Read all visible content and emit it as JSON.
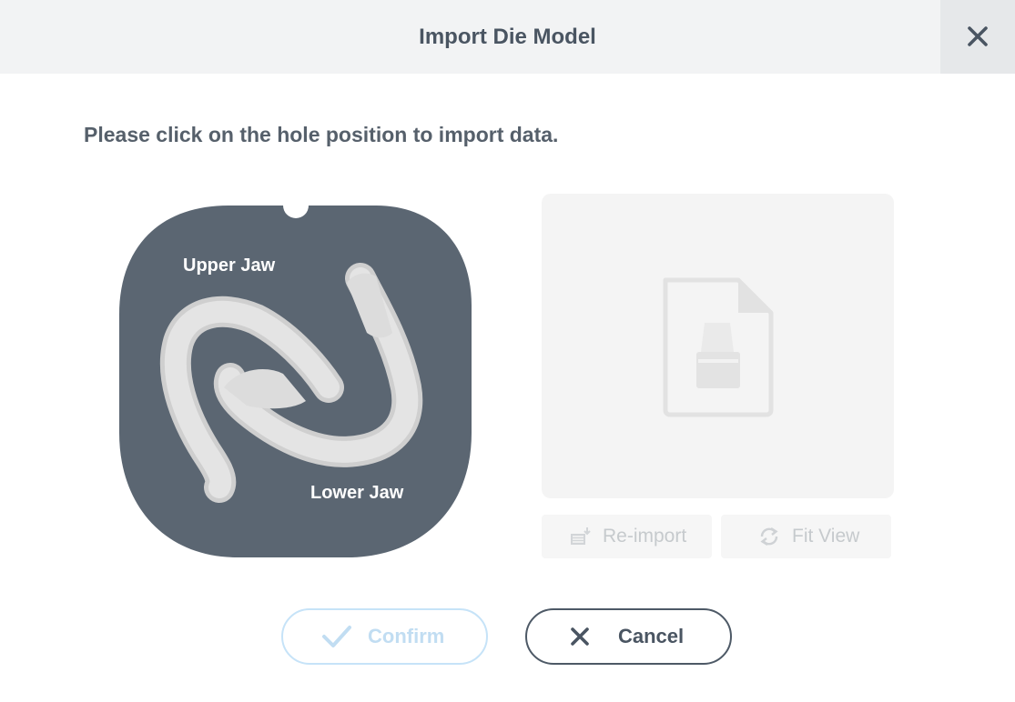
{
  "dialog": {
    "title": "Import Die Model",
    "instruction": "Please click on the hole position to import data."
  },
  "plate": {
    "upper_jaw_label": "Upper Jaw",
    "lower_jaw_label": "Lower Jaw",
    "plate_color": "#5b6672",
    "model_color": "#e2e2e2"
  },
  "preview": {
    "icon": "die-file-icon",
    "background": "#f4f4f4"
  },
  "tools": {
    "reimport_label": "Re-import",
    "reimport_icon": "reimport-icon",
    "fitview_label": "Fit View",
    "fitview_icon": "refresh-icon",
    "disabled_color": "#c6cacd"
  },
  "actions": {
    "confirm_label": "Confirm",
    "confirm_icon": "check-icon",
    "cancel_label": "Cancel",
    "cancel_icon": "close-icon",
    "confirm_color": "#c1ddf2",
    "cancel_color": "#4a5562"
  }
}
